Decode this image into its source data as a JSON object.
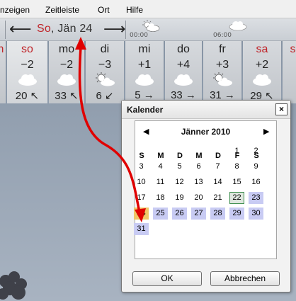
{
  "menu": {
    "items": [
      "nzeigen",
      "Zeitleiste",
      "Ort",
      "Hilfe"
    ]
  },
  "datebar": {
    "prev_arrow": "⟵",
    "next_arrow": "⟶",
    "date_weekday": "So",
    "date_rest": ", Jän 24",
    "times": [
      "00:00",
      "06:00"
    ]
  },
  "forecast": {
    "days": [
      {
        "name": "n",
        "temp": "",
        "wind": "",
        "sunday": true
      },
      {
        "name": "so",
        "temp": "−2",
        "wind": "20 ↖",
        "sunday": true,
        "selected": true,
        "icon": "cloud-icon"
      },
      {
        "name": "mo",
        "temp": "−2",
        "wind": "33 ↖",
        "icon": "cloud-icon"
      },
      {
        "name": "di",
        "temp": "−3",
        "wind": "6 ↙",
        "icon": "sun-cloud-icon"
      },
      {
        "name": "mi",
        "temp": "+1",
        "wind": "5 →",
        "icon": "cloud-icon"
      },
      {
        "name": "do",
        "temp": "+4",
        "wind": "33 →",
        "icon": "cloud-icon"
      },
      {
        "name": "fr",
        "temp": "+3",
        "wind": "31 →",
        "icon": "sun-cloud-icon"
      },
      {
        "name": "sa",
        "temp": "+2",
        "wind": "29 ↖",
        "sunday": true,
        "icon": "cloud-icon"
      },
      {
        "name": "s",
        "temp": "",
        "wind": "",
        "sunday": true
      }
    ]
  },
  "dialog": {
    "title": "Kalender",
    "close": "×",
    "month_label": "Jänner 2010",
    "prev": "◀",
    "next": "▶",
    "weekdays": [
      "S",
      "M",
      "D",
      "M",
      "D",
      "F",
      "S"
    ],
    "weeks": [
      [
        "",
        "",
        "",
        "",
        "",
        "1",
        "2"
      ],
      [
        "3",
        "4",
        "5",
        "6",
        "7",
        "8",
        "9"
      ],
      [
        "10",
        "11",
        "12",
        "13",
        "14",
        "15",
        "16"
      ],
      [
        "17",
        "18",
        "19",
        "20",
        "21",
        "22",
        "23"
      ],
      [
        "24",
        "25",
        "26",
        "27",
        "28",
        "29",
        "30"
      ],
      [
        "31",
        "",
        "",
        "",
        "",
        "",
        ""
      ]
    ],
    "today": "24",
    "boxed": "22",
    "highlighted": [
      "22",
      "23",
      "24",
      "25",
      "26",
      "27",
      "28",
      "29",
      "30",
      "31"
    ],
    "ok_label": "OK",
    "cancel_label": "Abbrechen"
  },
  "colors": {
    "accent_red": "#c0262b",
    "highlight": "#c8cbf3",
    "today": "#f0c667",
    "annotation": "#e00000"
  }
}
